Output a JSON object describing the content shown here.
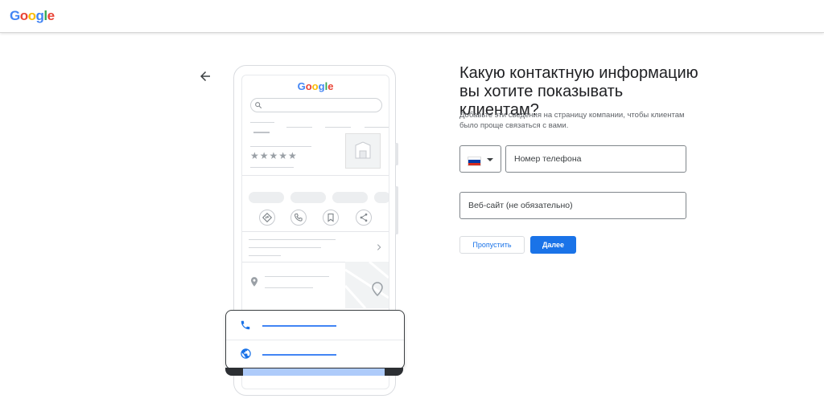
{
  "header": {
    "logo_letters": [
      {
        "ch": "G",
        "color": "#4285F4"
      },
      {
        "ch": "o",
        "color": "#EA4335"
      },
      {
        "ch": "o",
        "color": "#FBBC05"
      },
      {
        "ch": "g",
        "color": "#4285F4"
      },
      {
        "ch": "l",
        "color": "#34A853"
      },
      {
        "ch": "e",
        "color": "#EA4335"
      }
    ]
  },
  "nav": {
    "back_icon": "arrow-left-icon"
  },
  "illustration": {
    "logo_letters": [
      {
        "ch": "G",
        "color": "#4285F4"
      },
      {
        "ch": "o",
        "color": "#EA4335"
      },
      {
        "ch": "o",
        "color": "#FBBC05"
      },
      {
        "ch": "g",
        "color": "#4285F4"
      },
      {
        "ch": "l",
        "color": "#34A853"
      },
      {
        "ch": "e",
        "color": "#EA4335"
      }
    ],
    "stars": "★★★★★",
    "action_icons": [
      "directions-icon",
      "phone-icon",
      "bookmark-icon",
      "share-icon"
    ],
    "popup_icons": [
      "phone-icon",
      "globe-icon"
    ]
  },
  "form": {
    "headline": "Какую контактную информацию вы хотите показывать клиентам?",
    "subtext": "Добавьте эти сведения на страницу компании, чтобы клиентам было проще связаться с вами.",
    "country": {
      "flag_colors": [
        "#ffffff",
        "#0039a6",
        "#d52b1e"
      ]
    },
    "phone_placeholder": "Номер телефона",
    "phone_value": "",
    "website_placeholder": "Веб-сайт (не обязательно)",
    "website_value": "",
    "skip_label": "Пропустить",
    "next_label": "Далее"
  },
  "colors": {
    "accent": "#1a73e8",
    "border": "#80868b"
  }
}
